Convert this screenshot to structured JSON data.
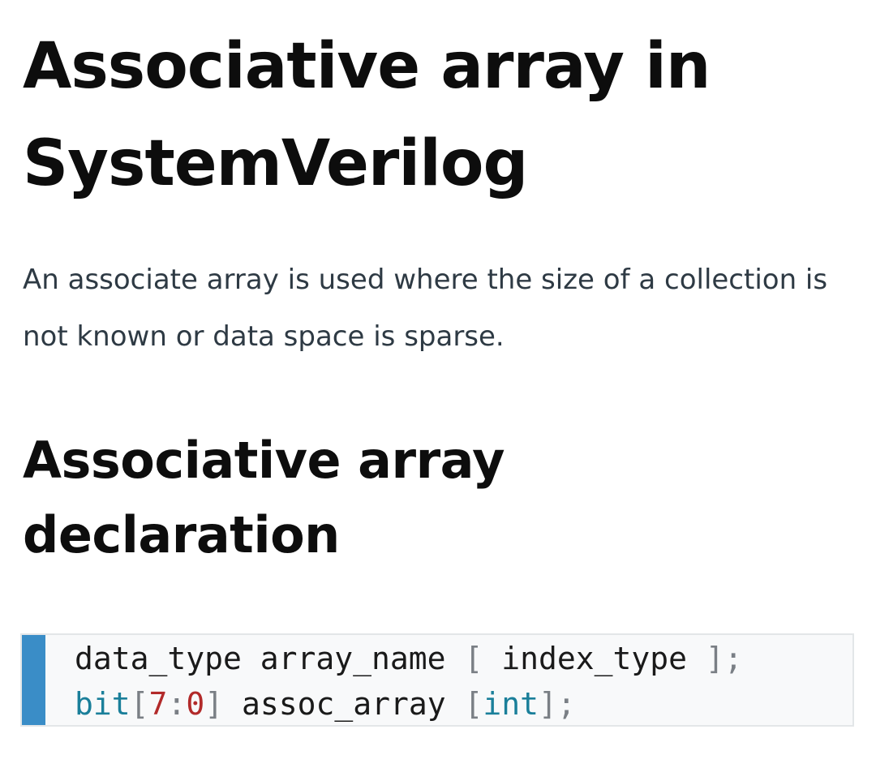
{
  "article": {
    "title": "Associative array in SystemVerilog",
    "intro": "An associate array is used where the size of a collection is not known or data space is sparse.",
    "section_heading": "Associative array declaration"
  },
  "code": {
    "line1": {
      "data_type": "data_type",
      "array_name": " array_name ",
      "open_bracket": "[",
      "index_type": " index_type ",
      "close": "];"
    },
    "line2": {
      "bit": "bit",
      "open_bracket": "[",
      "num_hi": "7",
      "colon": ":",
      "num_lo": "0",
      "close_bracket": "]",
      "assoc_array": " assoc_array ",
      "open_bracket2": "[",
      "int": "int",
      "close": "];"
    }
  },
  "colors": {
    "code_accent_bar": "#3a8dc7",
    "keyword": "#1a7f9a",
    "number": "#b22a2a",
    "punctuation": "#7a7f85"
  }
}
